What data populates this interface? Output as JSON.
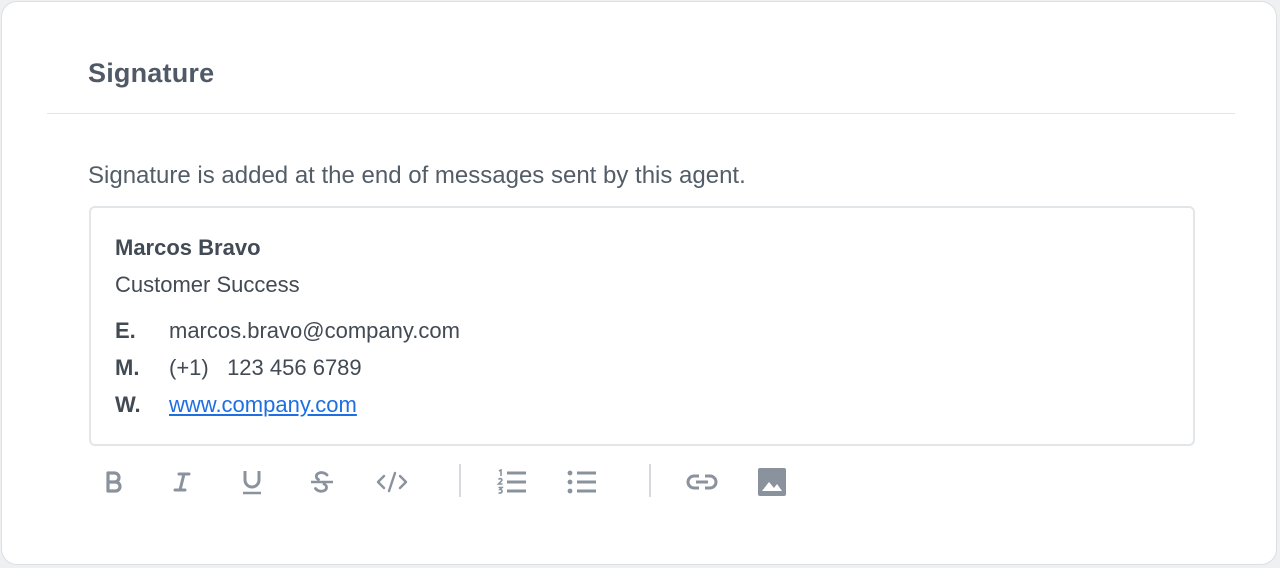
{
  "section": {
    "title": "Signature",
    "description": "Signature is added at the end of messages sent by this agent."
  },
  "signature": {
    "name": "Marcos Bravo",
    "role": "Customer Success",
    "contacts": [
      {
        "label": "E.",
        "value": "marcos.bravo@company.com"
      },
      {
        "label": "M.",
        "value": "(+1)   123 456 6789"
      },
      {
        "label": "W.",
        "value": "www.company.com"
      }
    ]
  },
  "toolbar": {
    "buttons": [
      {
        "name": "bold",
        "icon": "bold-icon"
      },
      {
        "name": "italic",
        "icon": "italic-icon"
      },
      {
        "name": "underline",
        "icon": "underline-icon"
      },
      {
        "name": "strikethrough",
        "icon": "strikethrough-icon"
      },
      {
        "name": "code",
        "icon": "code-icon"
      },
      {
        "name": "numbered-list",
        "icon": "ordered-list-icon"
      },
      {
        "name": "bulleted-list",
        "icon": "bullet-list-icon"
      },
      {
        "name": "link",
        "icon": "link-icon"
      },
      {
        "name": "image",
        "icon": "image-icon"
      }
    ]
  },
  "colors": {
    "link": "#1f6fe0",
    "text": "#424a54",
    "icon": "#8a939d"
  }
}
